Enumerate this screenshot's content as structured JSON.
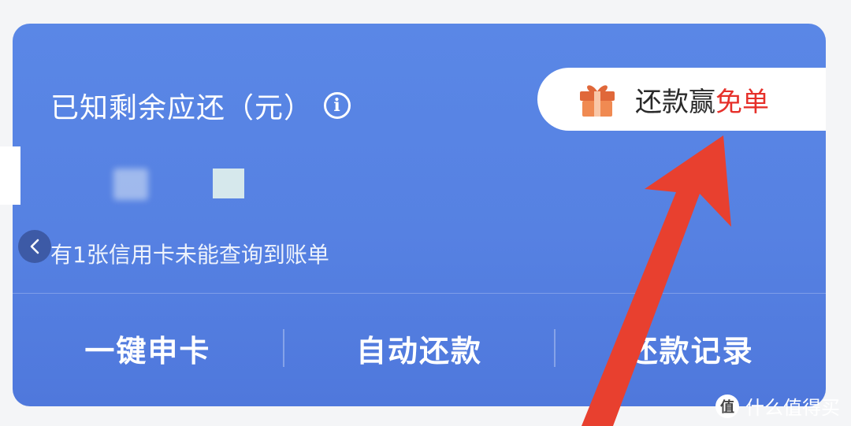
{
  "header": {
    "title": "已知剩余应还（元）",
    "info_icon_glyph": "i"
  },
  "promo": {
    "icon": "gift-icon",
    "text_prefix": "还款赢",
    "text_highlight": "免单",
    "highlight_color": "#e6302a"
  },
  "notice": {
    "text": "有1张信用卡未能查询到账单"
  },
  "nav": {
    "back_glyph": "‹"
  },
  "actions": [
    {
      "label": "一键申卡"
    },
    {
      "label": "自动还款"
    },
    {
      "label": "还款记录"
    }
  ],
  "watermark": {
    "logo_glyph": "值",
    "text": "什么值得买"
  },
  "colors": {
    "card_background": "#5681e2",
    "annotation_arrow": "#e8402f",
    "back_button": "#3d5aa6"
  }
}
